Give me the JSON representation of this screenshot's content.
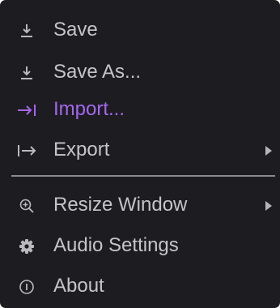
{
  "menu": {
    "items": [
      {
        "label": "Save",
        "icon": "download-icon"
      },
      {
        "label": "Save As...",
        "icon": "download-icon"
      },
      {
        "label": "Import...",
        "icon": "import-arrow-icon",
        "active": true
      },
      {
        "label": "Export",
        "icon": "export-arrow-icon",
        "submenu": true
      },
      {
        "label": "Resize Window",
        "icon": "zoom-in-icon",
        "submenu": true
      },
      {
        "label": "Audio Settings",
        "icon": "gear-icon"
      },
      {
        "label": "About",
        "icon": "info-icon"
      }
    ]
  },
  "colors": {
    "background": "#1d1d21",
    "text": "#c4c4ca",
    "accent": "#a566ee",
    "separator": "#8a8a90"
  }
}
